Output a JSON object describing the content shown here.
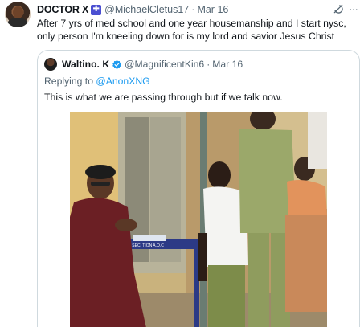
{
  "tweet": {
    "author_name": "DOCTOR X",
    "author_handle": "@MichaelCletus17",
    "separator": "·",
    "date": "Mar 16",
    "text": "After 7 yrs of med school and one year housemanship and I start nysc, only person I'm kneeling down for is my lord and savior Jesus Christ",
    "badge_icon": "medical-staff-icon",
    "more_label": "···"
  },
  "quoted_tweet": {
    "author_name": "Waltino. K",
    "author_handle": "@MagnificentKin6",
    "separator": "·",
    "date": "Mar 16",
    "replying_to_label": "Replying to",
    "replying_to_handle": "@AnonXNG",
    "text": "This is what we are passing through but if we talk now.",
    "verified_icon": "verified-badge-icon"
  },
  "photo": {
    "description_icon": "photo",
    "sign_text": "NYSC SEC. TION A.O.C"
  },
  "colors": {
    "text_primary": "#0f1419",
    "text_secondary": "#536471",
    "link": "#1d9bf0",
    "border": "#cfd9de",
    "verified_blue": "#1d9bf0",
    "badge_purple": "#4b4fd1"
  }
}
